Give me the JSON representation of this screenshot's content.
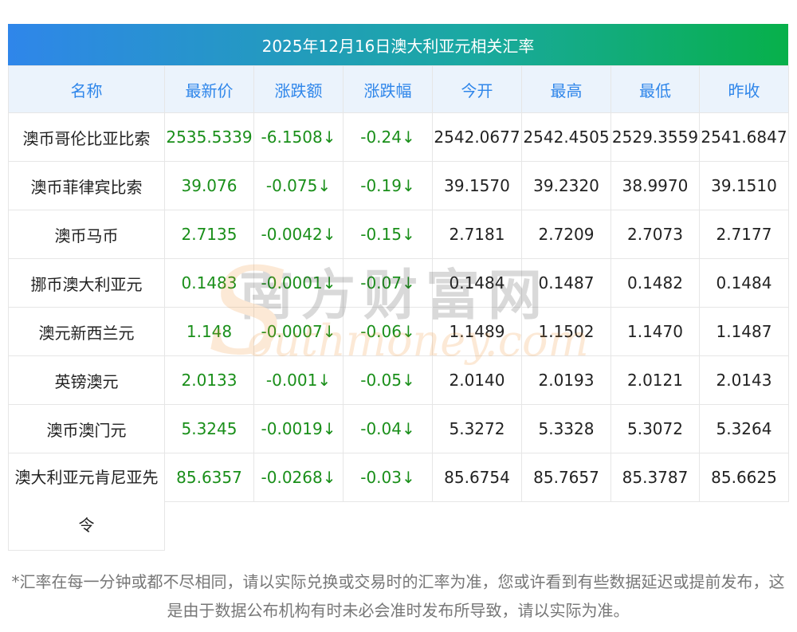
{
  "title": "2025年12月16日澳大利亚元相关汇率",
  "headers": [
    "名称",
    "最新价",
    "涨跌额",
    "涨跌幅",
    "今开",
    "最高",
    "最低",
    "昨收"
  ],
  "rows": [
    [
      "澳币哥伦比亚比索",
      "2535.5339",
      "-6.1508↓",
      "-0.24↓",
      "2542.0677",
      "2542.4505",
      "2529.3559",
      "2541.6847"
    ],
    [
      "澳币菲律宾比索",
      "39.076",
      "-0.075↓",
      "-0.19↓",
      "39.1570",
      "39.2320",
      "38.9970",
      "39.1510"
    ],
    [
      "澳币马币",
      "2.7135",
      "-0.0042↓",
      "-0.15↓",
      "2.7181",
      "2.7209",
      "2.7073",
      "2.7177"
    ],
    [
      "挪币澳大利亚元",
      "0.1483",
      "-0.0001↓",
      "-0.07↓",
      "0.1484",
      "0.1487",
      "0.1482",
      "0.1484"
    ],
    [
      "澳元新西兰元",
      "1.148",
      "-0.0007↓",
      "-0.06↓",
      "1.1489",
      "1.1502",
      "1.1470",
      "1.1487"
    ],
    [
      "英镑澳元",
      "2.0133",
      "-0.001↓",
      "-0.05↓",
      "2.0140",
      "2.0193",
      "2.0121",
      "2.0143"
    ],
    [
      "澳币澳门元",
      "5.3245",
      "-0.0019↓",
      "-0.04↓",
      "5.3272",
      "5.3328",
      "5.3072",
      "5.3264"
    ],
    [
      "澳大利亚元肯尼亚先令",
      "85.6357",
      "-0.0268↓",
      "-0.03↓",
      "85.6754",
      "85.7657",
      "85.3787",
      "85.6625"
    ]
  ],
  "watermark": {
    "cn": "南方财富网",
    "en": "outhmoney.com",
    "s": "S"
  },
  "footnote": "*汇率在每一分钟或都不尽相同，请以实际兑换或交易时的汇率为准，您或许看到有些数据延迟或提前发布，这是由于数据公布机构有时未必会准时发布所导致，请以实际为准。",
  "colors": {
    "header_text": "#2f86ea",
    "green_value": "#1a8f1a",
    "title_gradient_start": "#2f86ea",
    "title_gradient_end": "#07b04a"
  }
}
